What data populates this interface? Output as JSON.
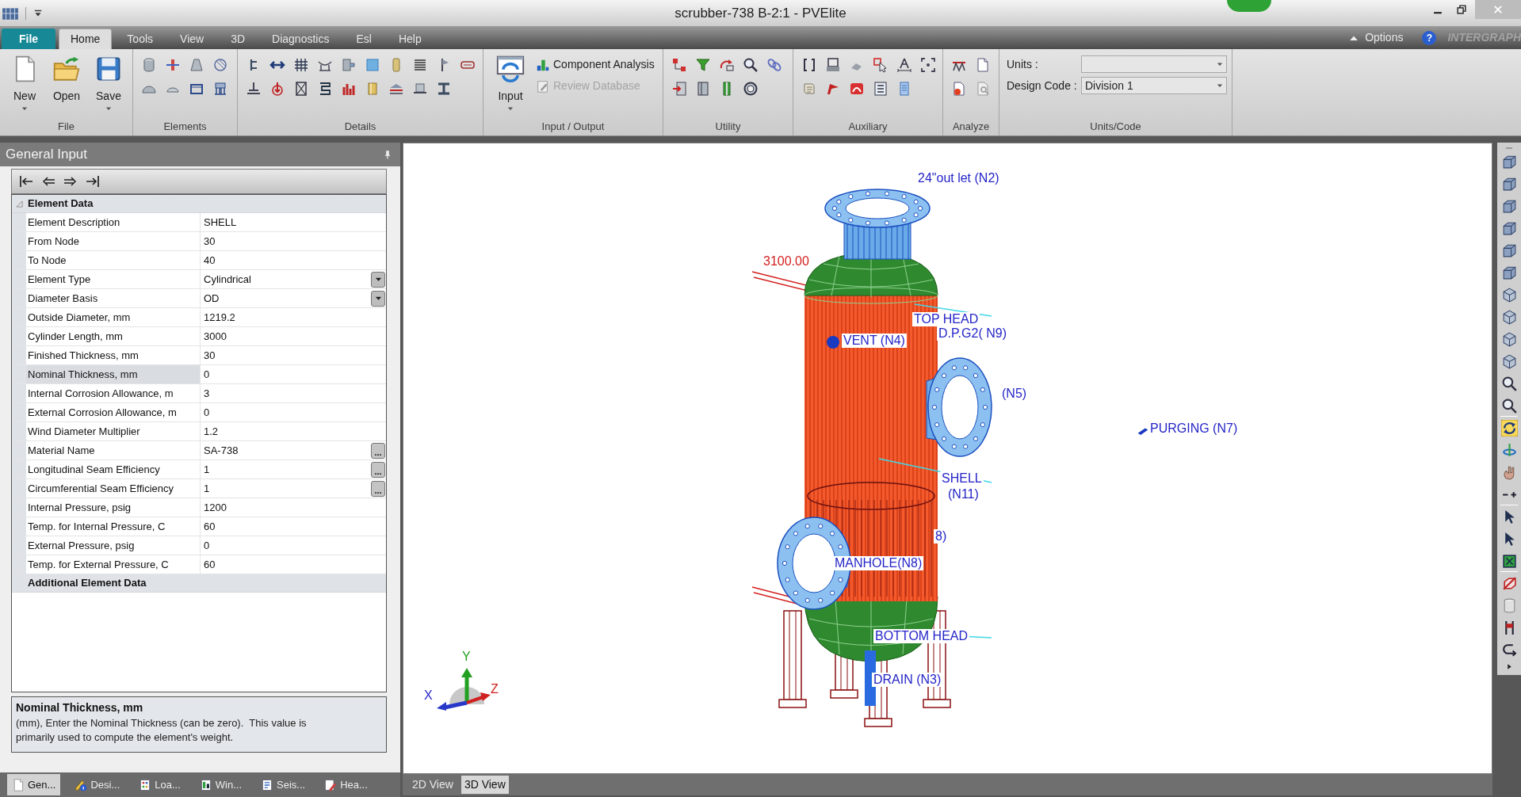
{
  "window": {
    "title": "scrubber-738 B-2:1 - PVElite"
  },
  "ribbon_tabs": [
    {
      "label": "File",
      "kind": "backstage",
      "selected": false
    },
    {
      "label": "Home",
      "kind": "tab",
      "selected": true
    },
    {
      "label": "Tools",
      "kind": "tab",
      "selected": false
    },
    {
      "label": "View",
      "kind": "tab",
      "selected": false
    },
    {
      "label": "3D",
      "kind": "tab",
      "selected": false
    },
    {
      "label": "Diagnostics",
      "kind": "tab",
      "selected": false
    },
    {
      "label": "Esl",
      "kind": "tab",
      "selected": false
    },
    {
      "label": "Help",
      "kind": "tab",
      "selected": false
    }
  ],
  "ribbon_options": {
    "label": "Options",
    "help": "?",
    "logo": "INTERGRAPH"
  },
  "ribbon_groups": [
    {
      "label": "File",
      "kind": "large",
      "buttons": [
        {
          "label": "New",
          "menu": true
        },
        {
          "label": "Open",
          "menu": false
        },
        {
          "label": "Save",
          "menu": true
        }
      ]
    },
    {
      "label": "Elements",
      "kind": "icons"
    },
    {
      "label": "Details",
      "kind": "icons"
    },
    {
      "label": "Input / Output",
      "kind": "io",
      "buttons": [
        {
          "label": "Input",
          "menu": true
        }
      ],
      "commands": [
        {
          "label": "Component Analysis",
          "disabled": false
        },
        {
          "label": "Review Database",
          "disabled": true
        }
      ]
    },
    {
      "label": "Utility",
      "kind": "icons"
    },
    {
      "label": "Auxiliary",
      "kind": "icons"
    },
    {
      "label": "Analyze",
      "kind": "icons"
    },
    {
      "label": "Units/Code",
      "kind": "fields",
      "fields": [
        {
          "label": "Units :"
        },
        {
          "label": "Design Code :",
          "value": "Division 1"
        }
      ]
    }
  ],
  "general_input": {
    "title": "General Input",
    "categories": [
      {
        "label": "Element Data",
        "expanded": true,
        "rows": [
          {
            "label": "Element Description",
            "value": "SHELL",
            "kind": "text",
            "selected": false
          },
          {
            "label": "From Node",
            "value": "30",
            "kind": "text",
            "selected": false
          },
          {
            "label": "To Node",
            "value": "40",
            "kind": "text",
            "selected": false
          },
          {
            "label": "Element Type",
            "value": "Cylindrical",
            "kind": "dropdown",
            "selected": false
          },
          {
            "label": "Diameter Basis",
            "value": "OD",
            "kind": "dropdown",
            "selected": false
          },
          {
            "label": "Outside Diameter, mm",
            "value": "1219.2",
            "kind": "text",
            "selected": false
          },
          {
            "label": "Cylinder Length, mm",
            "value": "3000",
            "kind": "text",
            "selected": false
          },
          {
            "label": "Finished Thickness, mm",
            "value": "30",
            "kind": "text",
            "selected": false
          },
          {
            "label": "Nominal Thickness, mm",
            "value": "0",
            "kind": "text",
            "selected": true
          },
          {
            "label": "Internal Corrosion Allowance, m",
            "value": "3",
            "kind": "text",
            "selected": false
          },
          {
            "label": "External Corrosion Allowance, m",
            "value": "0",
            "kind": "text",
            "selected": false
          },
          {
            "label": "Wind Diameter Multiplier",
            "value": "1.2",
            "kind": "text",
            "selected": false
          },
          {
            "label": "Material Name",
            "value": "SA-738",
            "kind": "browse",
            "button": "...",
            "selected": false
          },
          {
            "label": "Longitudinal Seam Efficiency",
            "value": "1",
            "kind": "browse",
            "button": "...",
            "selected": false
          },
          {
            "label": "Circumferential Seam Efficiency",
            "value": "1",
            "kind": "browse",
            "button": "...",
            "selected": false
          },
          {
            "label": "Internal Pressure, psig",
            "value": "1200",
            "kind": "text",
            "selected": false
          },
          {
            "label": "Temp. for Internal Pressure, C",
            "value": "60",
            "kind": "text",
            "selected": false
          },
          {
            "label": "External Pressure, psig",
            "value": "0",
            "kind": "text",
            "selected": false
          },
          {
            "label": "Temp. for External Pressure, C",
            "value": "60",
            "kind": "text",
            "selected": false
          }
        ]
      },
      {
        "label": "Additional Element Data",
        "expanded": false
      }
    ],
    "help": {
      "title": "Nominal Thickness, mm",
      "text": "(mm), Enter the Nominal Thickness (can be zero).  This value is primarily used to compute the element's weight."
    }
  },
  "input_tabs": [
    {
      "label": "Gen...",
      "selected": true
    },
    {
      "label": "Desi...",
      "selected": false
    },
    {
      "label": "Loa...",
      "selected": false
    },
    {
      "label": "Win...",
      "selected": false
    },
    {
      "label": "Seis...",
      "selected": false
    },
    {
      "label": "Hea...",
      "selected": false
    }
  ],
  "viewport": {
    "labels": [
      {
        "text": "24\"out let (N2)",
        "color": "#2424c8"
      },
      {
        "text": "3100.00",
        "color": "#d42020"
      },
      {
        "text": "TOP HEAD",
        "color": "#2424c8"
      },
      {
        "text": "D.P.G2( N9)",
        "color": "#2424c8"
      },
      {
        "text": "VENT (N4)",
        "color": "#2424c8"
      },
      {
        "text": "(N5)",
        "color": "#2424c8"
      },
      {
        "text": "PURGING (N7)",
        "color": "#2424c8"
      },
      {
        "text": "SHELL",
        "color": "#2424c8"
      },
      {
        "text": "(N11)",
        "color": "#2424c8"
      },
      {
        "text": "8)",
        "color": "#2424c8"
      },
      {
        "text": "MANHOLE(N8)",
        "color": "#2424c8"
      },
      {
        "text": "BOTTOM HEAD",
        "color": "#2424c8"
      },
      {
        "text": "DRAIN (N3)",
        "color": "#2424c8"
      }
    ],
    "axes": [
      {
        "label": "X",
        "color": "#2828c8"
      },
      {
        "label": "Y",
        "color": "#22a022"
      },
      {
        "label": "Z",
        "color": "#d02020"
      }
    ],
    "tabs": [
      {
        "label": "2D View",
        "selected": false
      },
      {
        "label": "3D View",
        "selected": true
      }
    ]
  },
  "view_toolbar": [
    {
      "tools": [
        {
          "kind": "cube",
          "selected": false
        },
        {
          "kind": "cube",
          "selected": false
        },
        {
          "kind": "cube",
          "selected": false
        },
        {
          "kind": "cube",
          "selected": false
        },
        {
          "kind": "cube",
          "selected": false
        },
        {
          "kind": "cube",
          "selected": false
        },
        {
          "kind": "iso",
          "selected": false
        },
        {
          "kind": "iso",
          "selected": false
        },
        {
          "kind": "iso",
          "selected": false
        },
        {
          "kind": "iso",
          "selected": false
        },
        {
          "kind": "zoom",
          "selected": false
        },
        {
          "kind": "zoom",
          "selected": false
        }
      ]
    },
    {
      "tools": [
        {
          "kind": "rotate",
          "selected": true
        },
        {
          "kind": "spin",
          "selected": false
        },
        {
          "kind": "pan",
          "selected": false
        },
        {
          "kind": "step",
          "selected": false
        }
      ]
    },
    {
      "tools": [
        {
          "kind": "select",
          "selected": false
        },
        {
          "kind": "select",
          "selected": false
        },
        {
          "kind": "fit",
          "selected": false
        }
      ]
    },
    {
      "tools": [
        {
          "kind": "section",
          "selected": false
        },
        {
          "kind": "cylinder",
          "selected": false
        },
        {
          "kind": "stand",
          "selected": false
        },
        {
          "kind": "hook",
          "selected": false
        }
      ]
    }
  ]
}
